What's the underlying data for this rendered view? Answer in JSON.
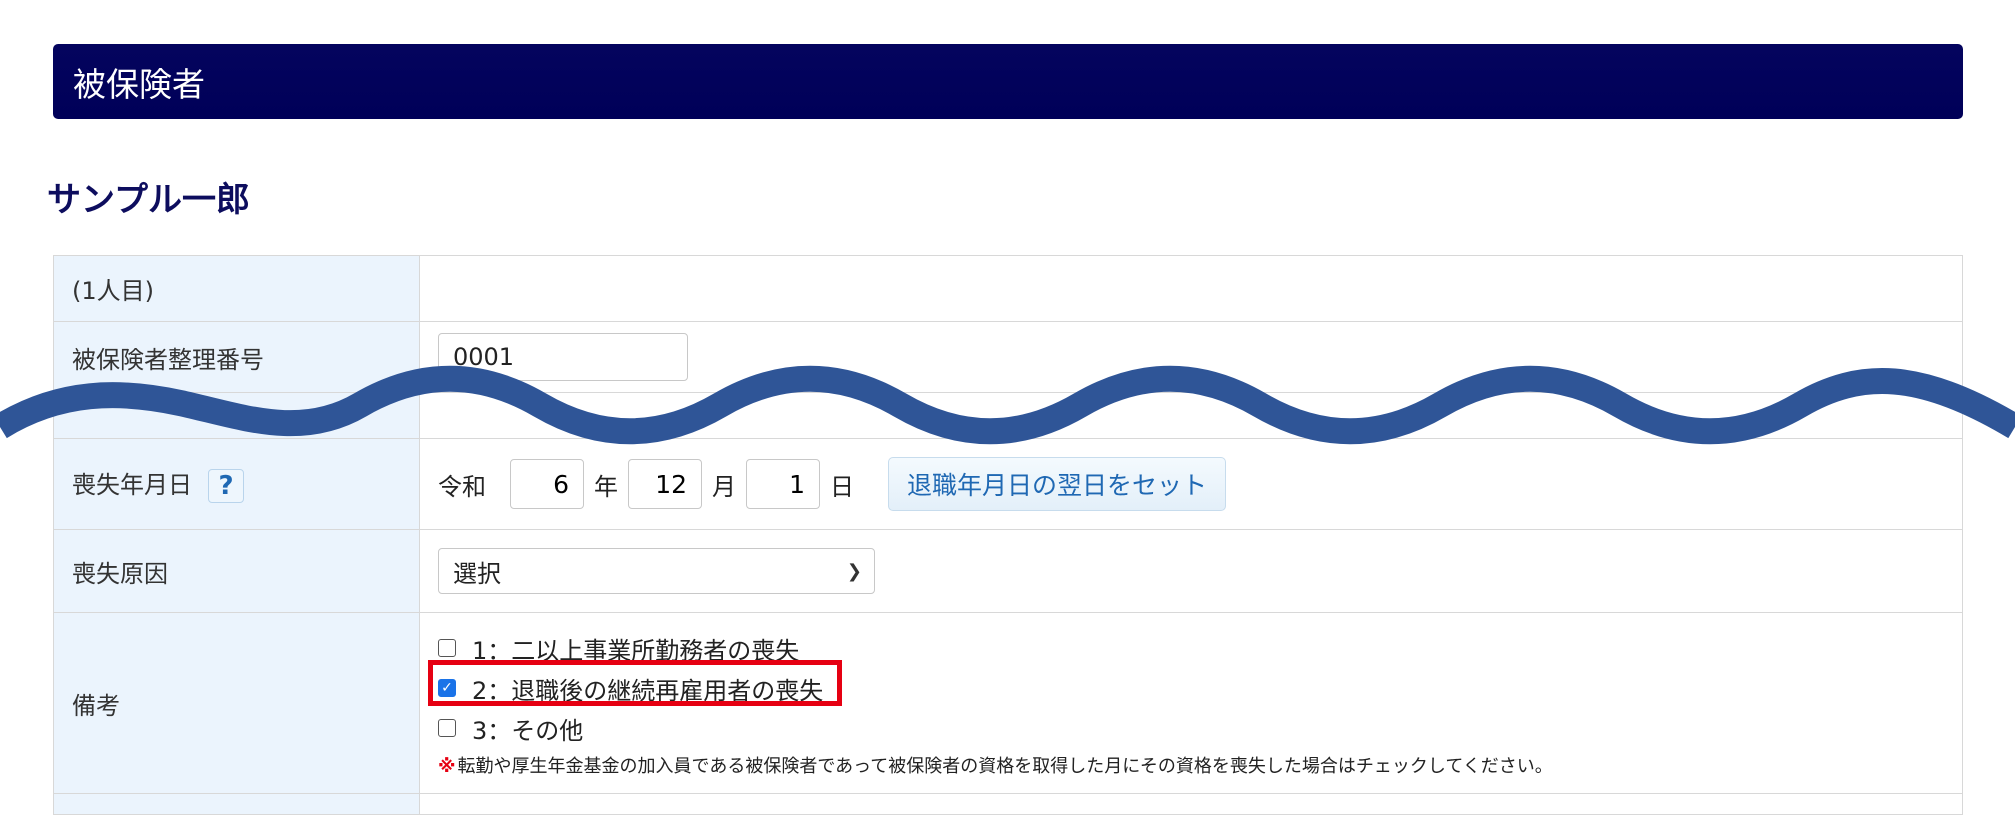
{
  "header": {
    "title": "被保険者"
  },
  "person": {
    "name": "サンプル一郎"
  },
  "rows": {
    "index_label": "(1人目)",
    "insured_number": {
      "label": "被保険者整理番号",
      "value": "0001"
    },
    "loss_date": {
      "label": "喪失年月日",
      "help": "?",
      "era": "令和",
      "year": "6",
      "year_unit": "年",
      "month": "12",
      "month_unit": "月",
      "day": "1",
      "day_unit": "日",
      "button": "退職年月日の翌日をセット"
    },
    "loss_reason": {
      "label": "喪失原因",
      "selected": "選択"
    },
    "remarks": {
      "label": "備考",
      "options": [
        {
          "text": "1：二以上事業所勤務者の喪失",
          "checked": false
        },
        {
          "text": "2：退職後の継続再雇用者の喪失",
          "checked": true
        },
        {
          "text": "3：その他",
          "checked": false
        }
      ],
      "note_mark": "※",
      "note": "転勤や厚生年金基金の加入員である被保険者であって被保険者の資格を取得した月にその資格を喪失した場合はチェックしてください。"
    }
  },
  "colors": {
    "header_bg": "#000058",
    "label_bg": "#ebf4fd",
    "wave": "#2f5597",
    "highlight": "#e60012",
    "checkbox_checked": "#1a73e8"
  }
}
